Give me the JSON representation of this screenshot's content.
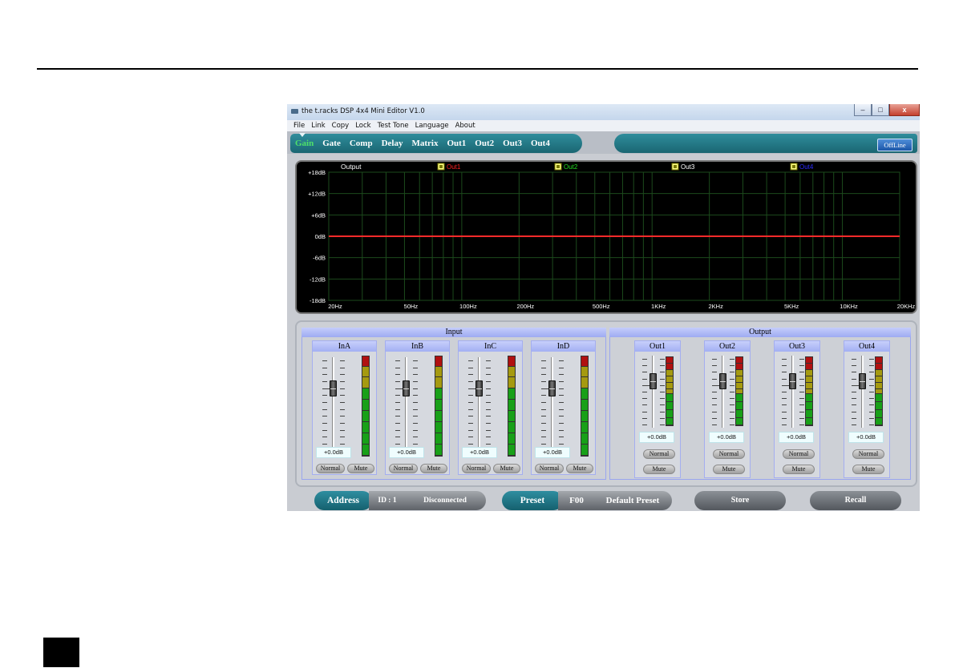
{
  "window": {
    "title": "the t.racks DSP 4x4 Mini Editor V1.0",
    "minimize": "–",
    "maximize": "□",
    "close": "x"
  },
  "menu": [
    "File",
    "Link",
    "Copy",
    "Lock",
    "Test Tone",
    "Language",
    "About"
  ],
  "tabs": [
    {
      "label": "Gain",
      "active": true
    },
    {
      "label": "Gate",
      "active": false
    },
    {
      "label": "Comp",
      "active": false
    },
    {
      "label": "Delay",
      "active": false
    },
    {
      "label": "Matrix",
      "active": false
    },
    {
      "label": "Out1",
      "active": false
    },
    {
      "label": "Out2",
      "active": false
    },
    {
      "label": "Out3",
      "active": false
    },
    {
      "label": "Out4",
      "active": false
    }
  ],
  "status_button": "OffLine",
  "graph": {
    "title": "Output",
    "legend": [
      {
        "name": "Out1",
        "color": "#ff2020"
      },
      {
        "name": "Out2",
        "color": "#22dd22"
      },
      {
        "name": "Out3",
        "color": "#ffffff"
      },
      {
        "name": "Out4",
        "color": "#2a2aff"
      }
    ],
    "y_labels": [
      "+18dB",
      "+12dB",
      "+6dB",
      "0dB",
      "-6dB",
      "-12dB",
      "-18dB"
    ],
    "x_labels": [
      "20Hz",
      "50Hz",
      "100Hz",
      "200Hz",
      "500Hz",
      "1KHz",
      "2KHz",
      "5KHz",
      "10KHz",
      "20KHz"
    ],
    "curve_color": "#ff2a2a"
  },
  "chart_data": {
    "type": "line",
    "title": "Output",
    "x_scale": "log",
    "xlim": [
      20,
      20000
    ],
    "ylim": [
      -18,
      18
    ],
    "x": [
      20,
      20000
    ],
    "series": [
      {
        "name": "Out1",
        "values": [
          0,
          0
        ]
      },
      {
        "name": "Out2",
        "values": [
          0,
          0
        ]
      },
      {
        "name": "Out3",
        "values": [
          0,
          0
        ]
      },
      {
        "name": "Out4",
        "values": [
          0,
          0
        ]
      }
    ],
    "legend_position": "top",
    "grid": true
  },
  "input_section": {
    "title": "Input",
    "channels": [
      {
        "name": "InA",
        "gain": "+0.0dB",
        "normal": "Normal",
        "mute": "Mute"
      },
      {
        "name": "InB",
        "gain": "+0.0dB",
        "normal": "Normal",
        "mute": "Mute"
      },
      {
        "name": "InC",
        "gain": "+0.0dB",
        "normal": "Normal",
        "mute": "Mute"
      },
      {
        "name": "InD",
        "gain": "+0.0dB",
        "normal": "Normal",
        "mute": "Mute"
      }
    ]
  },
  "output_section": {
    "title": "Output",
    "channels": [
      {
        "name": "Out1",
        "gain": "+0.0dB",
        "normal": "Normal",
        "mute": "Mute"
      },
      {
        "name": "Out2",
        "gain": "+0.0dB",
        "normal": "Normal",
        "mute": "Mute"
      },
      {
        "name": "Out3",
        "gain": "+0.0dB",
        "normal": "Normal",
        "mute": "Mute"
      },
      {
        "name": "Out4",
        "gain": "+0.0dB",
        "normal": "Normal",
        "mute": "Mute"
      }
    ]
  },
  "bottom": {
    "address_label": "Address",
    "id_label": "ID : 1",
    "connection_status": "Disconnected",
    "preset_label": "Preset",
    "preset_number": "F00",
    "preset_name": "Default Preset",
    "store": "Store",
    "recall": "Recall"
  },
  "colors": {
    "teal": "#1f7685",
    "active_tab": "#4fe06a",
    "meter_red": "#b01010",
    "meter_yellow": "#a59a10",
    "meter_green": "#18a018"
  }
}
